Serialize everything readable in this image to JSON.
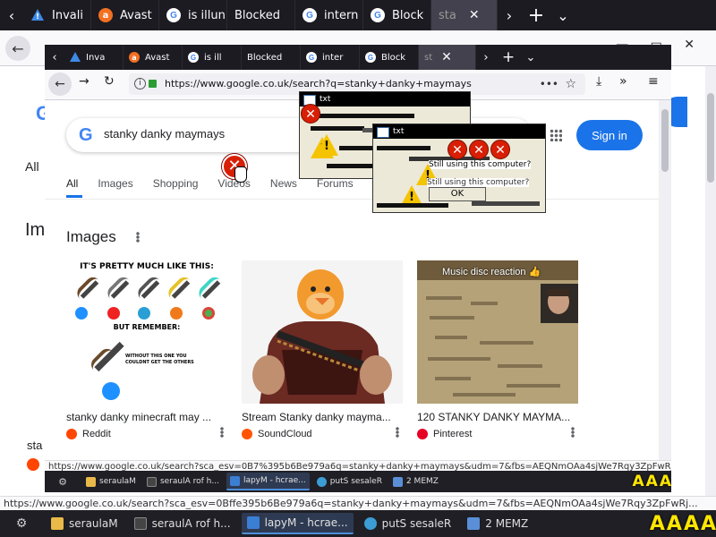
{
  "outer": {
    "tabs": [
      {
        "label": "Invali",
        "favicon": "warning-icon"
      },
      {
        "label": "Avast",
        "favicon": "avast-icon"
      },
      {
        "label": "is illun",
        "favicon": "google-icon"
      },
      {
        "label": "Blocked",
        "favicon": "none"
      },
      {
        "label": "intern",
        "favicon": "google-icon"
      },
      {
        "label": "Block",
        "favicon": "google-icon"
      },
      {
        "label": "sta",
        "favicon": "none",
        "active": true
      }
    ],
    "tab_close": "✕",
    "new_tab": "+",
    "status_url": "https://www.google.co.uk/search?sca_esv=0Bffe395b6Be979a6q=stanky+danky+maymays&udm=7&fbs=AEQNmOAa4sjWe7Rqy3ZpFwRj...",
    "page": {
      "all_tab": "All",
      "images_heading": "Ima",
      "first_caption": "sta"
    },
    "taskbar": [
      {
        "label": "seraulaM",
        "icon": "folder-icon"
      },
      {
        "label": "seraulA rof h...",
        "icon": "terminal-icon"
      },
      {
        "label": "lapyM - hcrae...",
        "icon": "code-icon",
        "active": true
      },
      {
        "label": "putS sesaleR",
        "icon": "globe-icon"
      },
      {
        "label": "2 MEMZ",
        "icon": "window-icon"
      }
    ],
    "tray_glyph": "A"
  },
  "inner": {
    "tabs": [
      {
        "label": "Inva",
        "favicon": "warning-icon"
      },
      {
        "label": "Avast",
        "favicon": "avast-icon"
      },
      {
        "label": "is ill",
        "favicon": "google-icon"
      },
      {
        "label": "Blocked",
        "favicon": "none"
      },
      {
        "label": "inter",
        "favicon": "google-icon"
      },
      {
        "label": "Block",
        "favicon": "google-icon"
      },
      {
        "label": "st",
        "favicon": "none",
        "active": true
      }
    ],
    "tab_close": "✕",
    "url": "https://www.google.co.uk/search?q=stanky+danky+maymays",
    "status_url": "https://www.google.co.uk/search?sca_esv=0B7%395b6Be979a6q=stanky+danky+maymays&udm=7&fbs=AEQNmOAa4sjWe7Rqy3ZpFwRj...",
    "search": {
      "query": "stanky danky maymays",
      "signin": "Sign in",
      "tabs": [
        "All",
        "Images",
        "Shopping",
        "Videos",
        "News",
        "Forums",
        "W"
      ]
    },
    "images_heading": "Images",
    "results": [
      {
        "caption": "stanky danky minecraft may ...",
        "source": "Reddit",
        "source_color": "#ff4500",
        "thumb_header": "IT'S PRETTY MUCH LIKE THIS:",
        "thumb_mid": "BUT REMEMBER:",
        "thumb_small": "WITHOUT THIS ONE YOU COULDNT GET THE OTHERS"
      },
      {
        "caption": "Stream Stanky danky mayma...",
        "source": "SoundCloud",
        "source_color": "#ff5500"
      },
      {
        "caption": "120 STANKY DANKY MAYMA...",
        "source": "Pinterest",
        "source_color": "#e60023",
        "thumb_header": "Music disc reaction 👍"
      }
    ],
    "taskbar": [
      {
        "label": "seraulaM",
        "icon": "folder-icon"
      },
      {
        "label": "seraulA rof h...",
        "icon": "terminal-icon"
      },
      {
        "label": "lapyM - hcrae...",
        "icon": "code-icon",
        "active": true
      },
      {
        "label": "putS sesaleR",
        "icon": "globe-icon"
      },
      {
        "label": "2 MEMZ",
        "icon": "window-icon"
      }
    ]
  },
  "popups": {
    "ok": "OK",
    "question": "Still using this computer?",
    "question_echo": "Still using this computer?",
    "title": "txt"
  }
}
